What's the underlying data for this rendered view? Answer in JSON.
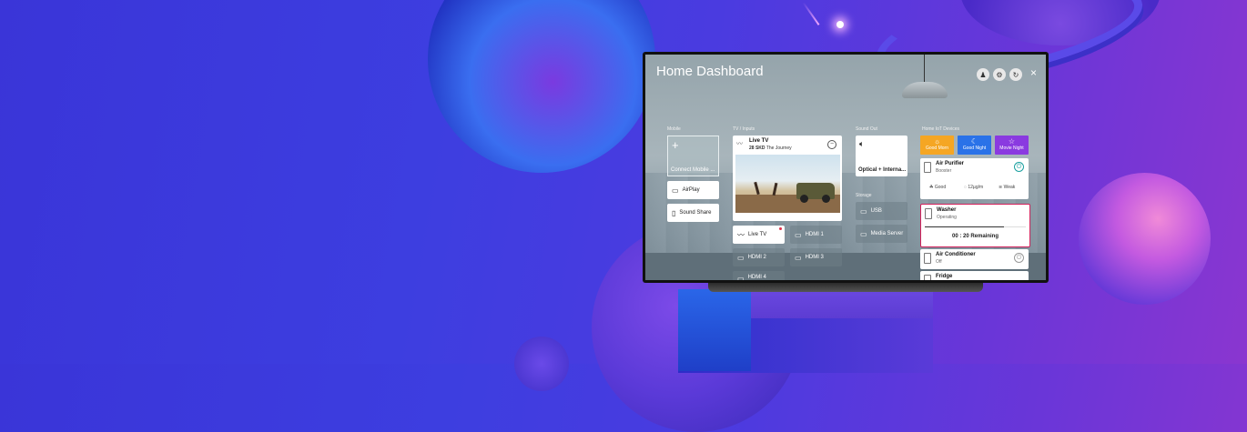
{
  "dashboard": {
    "title": "Home Dashboard",
    "close": "×"
  },
  "sections": {
    "mobile": "Mobile",
    "tv_inputs": "TV / Inputs",
    "sound_out": "Sound Out",
    "storage": "Storage",
    "iot": "Home IoT Devices"
  },
  "mobile": {
    "connect": "Connect Mobile ...",
    "airplay": "AirPlay",
    "sound_share": "Sound Share"
  },
  "tv": {
    "live_name": "Live TV",
    "channel": "28 SKD",
    "program": "The Journey",
    "inputs": [
      "Live TV",
      "HDMI 1",
      "HDMI 2",
      "HDMI 3",
      "HDMI 4"
    ]
  },
  "sound_out": {
    "label": "Optical + Interna..."
  },
  "storage": {
    "usb": "USB",
    "media_server": "Media Server"
  },
  "iot": {
    "modes": [
      {
        "label": "Good Morn",
        "color": "#f5a623"
      },
      {
        "label": "Good Night",
        "color": "#2a72e8"
      },
      {
        "label": "Movie Night",
        "color": "#8a3ae0"
      }
    ],
    "air_purifier": {
      "name": "Air Purifier",
      "status": "Booster",
      "quality": "Good",
      "pm": "12µg/m",
      "fan": "Weak"
    },
    "washer": {
      "name": "Washer",
      "status": "Operating",
      "remaining": "00 : 20 Remaining",
      "progress": 0.78
    },
    "air_conditioner": {
      "name": "Air Conditioner",
      "status": "Off"
    },
    "fridge": {
      "name": "Fridge"
    }
  }
}
